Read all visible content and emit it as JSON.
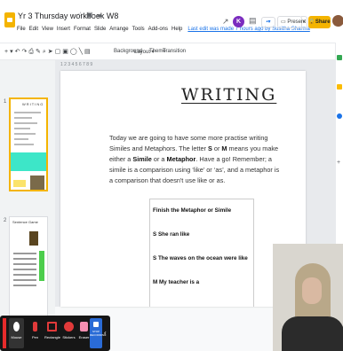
{
  "header": {
    "doc_title": "Yr 3 Thursday workbook W8",
    "title_icons": [
      "star-icon",
      "move-to-folder-icon",
      "cloud-status-icon"
    ],
    "menu": [
      "File",
      "Edit",
      "View",
      "Insert",
      "Format",
      "Slide",
      "Arrange",
      "Tools",
      "Add-ons",
      "Help"
    ],
    "last_edit": "Last edit was made 7 hours ago by Susitha Sharma",
    "present_label": "Present",
    "share_label": "Share",
    "avatar_letter": "K"
  },
  "toolbar": {
    "background": "Background",
    "layout": "Layout ▾",
    "theme": "Theme",
    "transition": "Transition",
    "ruler_numbers": "1        2        3        4        5        6        7        8        9"
  },
  "filmstrip": {
    "slide_numbers": [
      "1",
      "2"
    ],
    "thumb1_title": "WRITING",
    "thumb2_title": "Sentence Game"
  },
  "slide": {
    "title": "WRITING",
    "body": {
      "p1": "Today we are going to have some more practise writing Similes and Metaphors. The letter ",
      "s_letter": "S",
      "or1": " or ",
      "m_letter": "M",
      "p2": " means you make either a ",
      "simile": "Simile",
      "or2": " or a ",
      "metaphor": "Metaphor",
      "p3": ". Have a go! Remember; a simile is a comparison using ‘like’ or ‘as’, and a metaphor is a comparison that doesn't use like or as."
    },
    "box": {
      "heading": "Finish the Metaphor or Simile",
      "line1": "S She ran like",
      "line2": "S The waves on the ocean were like",
      "line3": "M My teacher is a"
    }
  },
  "draw_toolbar": {
    "items": [
      {
        "label": "Mouse",
        "icon": "mouse-icon"
      },
      {
        "label": "Pen",
        "icon": "pen-icon"
      },
      {
        "label": "Rectangle",
        "icon": "rectangle-icon"
      },
      {
        "label": "Stickers",
        "icon": "stickers-icon"
      },
      {
        "label": "Eraser",
        "icon": "eraser-icon"
      },
      {
        "label": "STOP RECORDING",
        "icon": "stop-icon"
      }
    ]
  },
  "colors": {
    "accent_yellow": "#f4b400",
    "link_blue": "#1a73e8",
    "teal": "#3de6c8"
  }
}
